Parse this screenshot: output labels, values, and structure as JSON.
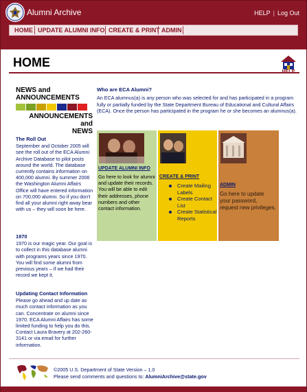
{
  "header": {
    "app_title": "Alumni Archive",
    "help_link": "HELP",
    "separator": "|",
    "logout_link": "Log Out",
    "colors": {
      "brand": "#8b1626",
      "nav_bg": "#f2e6e8"
    }
  },
  "nav": {
    "items": [
      {
        "label": "HOME"
      },
      {
        "label": "UPDATE ALUMNI INFO"
      },
      {
        "label": "CREATE & PRINT"
      },
      {
        "label": "ADMIN"
      }
    ]
  },
  "page": {
    "title": "HOME",
    "help_icon_label": "HELP"
  },
  "news": {
    "title_line1": "NEWS and",
    "title_line2": "ANNOUNCEMENTS",
    "title_line3": "ANNOUNCEMENTS and",
    "title_line4": "NEWS",
    "swatch_colors": [
      "#a3c43a",
      "#7aa024",
      "#c8a000",
      "#f2c800",
      "#1b2a8c",
      "#8b1626",
      "#e02020",
      "#2a3a9c"
    ],
    "items": [
      {
        "heading": "The Roll Out",
        "body": "September and October 2005 will see the roll out of the ECA Alumni Archive Database to pilot posts around the world. The database currently contains information on 400,000 alumni. By summer 2006 the Washington Alumni Affairs Office will have entered information on 700,000 alumni. So if you don't find all your alumni right away bear with us – they will soon be here."
      },
      {
        "heading": "1970",
        "body": "1970 is our magic year. Our goal is to collect in this database alumni with programs years since 1970. You will find some alumni from previous years – if we had their record we kept it."
      },
      {
        "heading": "Updating Contact Information",
        "body": "Please go ahead and up date as much contact information as you can. Concentrate on alumni since 1970. ECA Alumni Affairs has some limited funding to help you do this. Contact Laura Bravery at 202-260-3141 or via email for further information."
      }
    ]
  },
  "who": {
    "heading": "Who are ECA Alumni?",
    "body": "An ECA alumnus(a) is any person who was selected for and has participated in a program fully or partially funded by the State Department Bureau of Educational and Cultural Affairs (ECA). Once the person has participated in the program he or she becomes an alumnus(a)."
  },
  "panels": {
    "update": {
      "link": "UPDATE ALUMNI INFO",
      "text": "Go here to look for alumni and update their records. You will be able to edit their addresses, phone numbers and other contact information.",
      "color": "#c2d99c"
    },
    "create": {
      "link": "CREATE & PRINT",
      "items": [
        "Create Mailing Labels",
        "Create Contact List",
        "Create Statistical Reports"
      ],
      "color": "#f2c800"
    },
    "admin": {
      "link": "ADMIN",
      "text": "Go here to update your password, request new privileges.",
      "color": "#c8803a"
    }
  },
  "footer": {
    "copyright": "©2005 U.S. Department of State  Version – 1.0",
    "contact_prefix": "Please send comments and questions to: ",
    "email": "AlumniArchive@state.gov"
  }
}
